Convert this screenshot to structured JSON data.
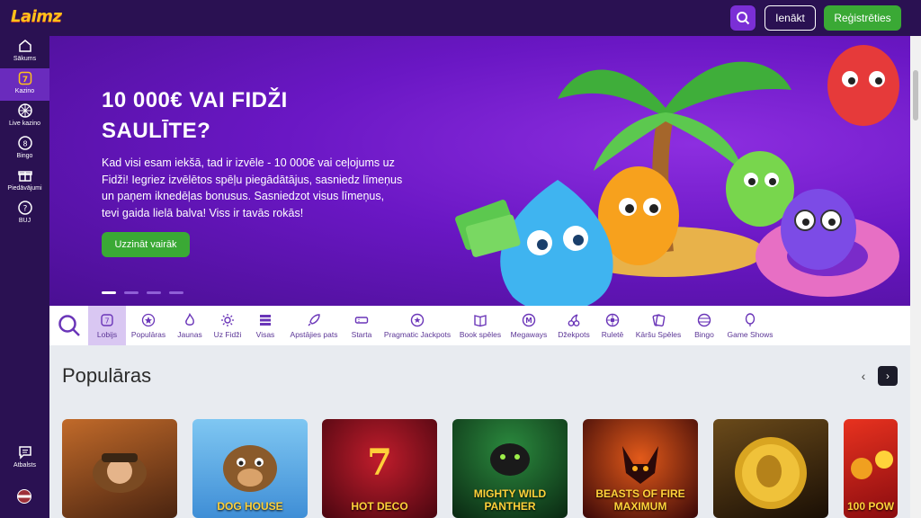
{
  "header": {
    "logo": "Laimz",
    "login_label": "Ienākt",
    "register_label": "Reģistrēties",
    "search_icon": "search-icon"
  },
  "sidebar": {
    "items": [
      {
        "label": "Sākums",
        "icon": "home-icon"
      },
      {
        "label": "Kazino",
        "icon": "slot-icon",
        "active": true
      },
      {
        "label": "Live kazino",
        "icon": "roulette-icon"
      },
      {
        "label": "Bingo",
        "icon": "bingo-ball-icon"
      },
      {
        "label": "Piedāvājumi",
        "icon": "gift-icon"
      },
      {
        "label": "BUJ",
        "icon": "help-icon"
      }
    ],
    "support_label": "Atbalsts",
    "language_flag": "latvia-flag"
  },
  "hero": {
    "title": "10 000€ VAI FIDŽI SAULĪTE?",
    "text": "Kad visi esam iekšā, tad ir izvēle - 10 000€ vai ceļojums uz Fidži! Iegriez izvēlētos spēļu piegādātājus, sasniedz līmeņus un paņem iknedēļas bonusus. Sasniedzot visus līmeņus, tevi gaida lielā balva! Viss ir tavās rokās!",
    "cta_label": "Uzzināt vairāk",
    "slides": 4,
    "active_slide": 1
  },
  "categories": [
    {
      "label": "Lobijs",
      "icon": "lobby-icon",
      "active": true
    },
    {
      "label": "Populāras",
      "icon": "star-icon"
    },
    {
      "label": "Jaunas",
      "icon": "flame-icon"
    },
    {
      "label": "Uz Fidži",
      "icon": "sun-icon"
    },
    {
      "label": "Visas",
      "icon": "stack-icon"
    },
    {
      "label": "Apstājies pats",
      "icon": "rocket-icon"
    },
    {
      "label": "Starta",
      "icon": "ticket-icon"
    },
    {
      "label": "Pragmatic Jackpots",
      "icon": "jackpot-icon"
    },
    {
      "label": "Book spēles",
      "icon": "book-icon"
    },
    {
      "label": "Megaways",
      "icon": "megaways-icon"
    },
    {
      "label": "Džekpots",
      "icon": "cherries-icon"
    },
    {
      "label": "Ruletē",
      "icon": "roulette-icon"
    },
    {
      "label": "Kāršu Spēles",
      "icon": "cards-icon"
    },
    {
      "label": "Bingo",
      "icon": "bingo-ball-icon"
    },
    {
      "label": "Game Shows",
      "icon": "balloon-icon"
    }
  ],
  "section": {
    "title": "Populāras",
    "prev": "‹",
    "next": "›"
  },
  "games": [
    {
      "title": "",
      "bg": "#6b3a1a"
    },
    {
      "title": "DOG HOUSE",
      "bg": "#3f8ed6"
    },
    {
      "title": "HOT DECO",
      "bg": "#8a0f1d"
    },
    {
      "title": "MIGHTY WILD PANTHER",
      "bg": "#0e3d1f"
    },
    {
      "title": "BEASTS OF FIRE MAXIMUM",
      "bg": "#4a0d0d"
    },
    {
      "title": "",
      "bg": "#2c1a0a"
    },
    {
      "title": "100 POW",
      "bg": "#c3141a"
    }
  ],
  "colors": {
    "brand_purple": "#2a1152",
    "accent_green": "#3aa935",
    "accent_violet": "#7b2fd6"
  }
}
